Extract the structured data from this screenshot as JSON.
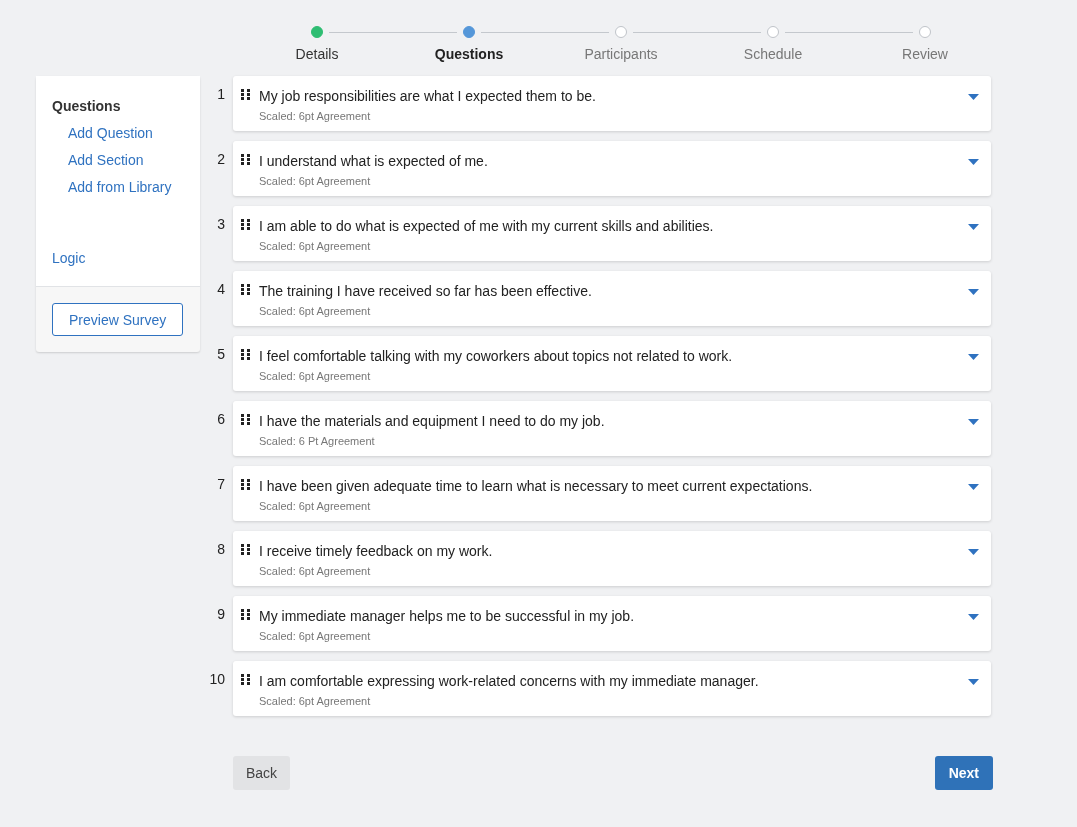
{
  "steps": [
    {
      "label": "Details",
      "completed": true,
      "selected": false
    },
    {
      "label": "Questions",
      "completed": false,
      "selected": true
    },
    {
      "label": "Participants",
      "completed": false,
      "selected": false
    },
    {
      "label": "Schedule",
      "completed": false,
      "selected": false
    },
    {
      "label": "Review",
      "completed": false,
      "selected": false
    }
  ],
  "sidebar": {
    "heading": "Questions",
    "items": [
      "Add Question",
      "Add Section",
      "Add from Library"
    ],
    "logic_link": "Logic",
    "preview_button": "Preview Survey"
  },
  "questions": [
    {
      "number": "1",
      "text": "My job responsibilities are what I expected them to be.",
      "scale": "Scaled: 6pt Agreement"
    },
    {
      "number": "2",
      "text": "I understand what is expected of me.",
      "scale": "Scaled: 6pt Agreement"
    },
    {
      "number": "3",
      "text": "I am able to do what is expected of me with my current skills and abilities.",
      "scale": "Scaled: 6pt Agreement"
    },
    {
      "number": "4",
      "text": "The training I have received so far has been effective.",
      "scale": "Scaled: 6pt Agreement"
    },
    {
      "number": "5",
      "text": "I feel comfortable talking with my coworkers about topics not related to work.",
      "scale": "Scaled: 6pt Agreement"
    },
    {
      "number": "6",
      "text": "I have the materials and equipment I need to do my job.",
      "scale": "Scaled: 6 Pt Agreement"
    },
    {
      "number": "7",
      "text": "I have been given adequate time to learn what is necessary to meet current expectations.",
      "scale": "Scaled: 6pt Agreement"
    },
    {
      "number": "8",
      "text": "I receive timely feedback on my work.",
      "scale": "Scaled: 6pt Agreement"
    },
    {
      "number": "9",
      "text": "My immediate manager helps me to be successful in my job.",
      "scale": "Scaled: 6pt Agreement"
    },
    {
      "number": "10",
      "text": "I am comfortable expressing work-related concerns with my immediate manager.",
      "scale": "Scaled: 6pt Agreement"
    }
  ],
  "buttons": {
    "back": "Back",
    "next": "Next"
  }
}
